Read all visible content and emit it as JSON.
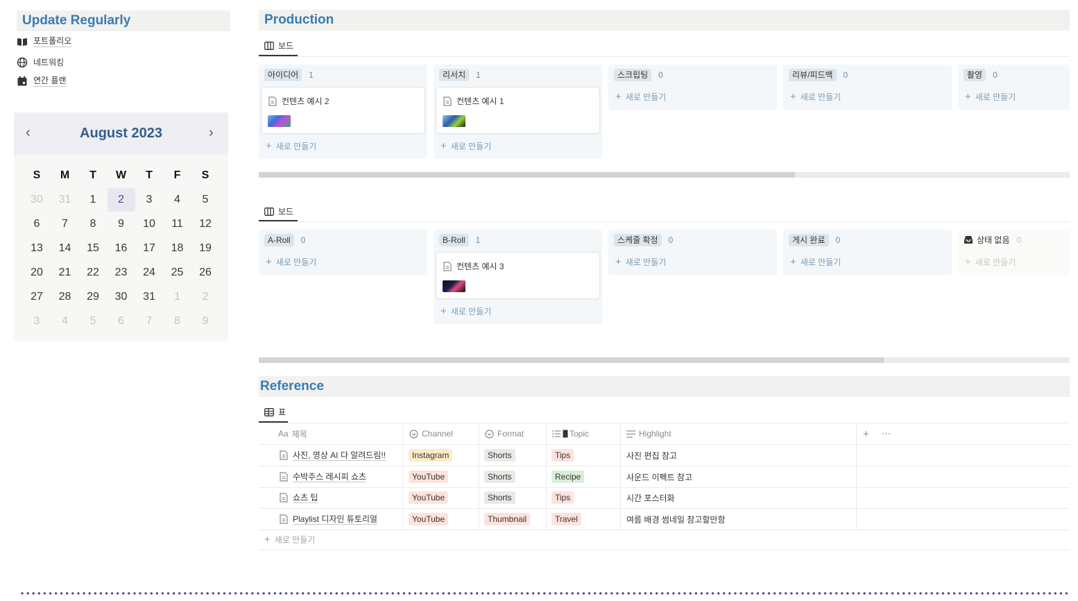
{
  "sidebar": {
    "title": "Update Regularly",
    "links": [
      {
        "label": "포트폴리오",
        "icon": "book-open-icon"
      },
      {
        "label": "네트워킹",
        "icon": "globe-icon"
      },
      {
        "label": "연간 플랜",
        "icon": "calendar-icon"
      }
    ]
  },
  "calendar": {
    "title": "August 2023",
    "weekdays": [
      "S",
      "M",
      "T",
      "W",
      "T",
      "F",
      "S"
    ],
    "weeks": [
      [
        "30",
        "31",
        "1",
        "2",
        "3",
        "4",
        "5"
      ],
      [
        "6",
        "7",
        "8",
        "9",
        "10",
        "11",
        "12"
      ],
      [
        "13",
        "14",
        "15",
        "16",
        "17",
        "18",
        "19"
      ],
      [
        "20",
        "21",
        "22",
        "23",
        "24",
        "25",
        "26"
      ],
      [
        "27",
        "28",
        "29",
        "30",
        "31",
        "1",
        "2"
      ],
      [
        "3",
        "4",
        "5",
        "6",
        "7",
        "8",
        "9"
      ]
    ]
  },
  "production": {
    "title": "Production",
    "board1": {
      "view_label": "보드",
      "columns": [
        {
          "name": "아이디어",
          "count": "1",
          "card": "컨텐츠 예시 2"
        },
        {
          "name": "리서치",
          "count": "1",
          "card": "컨텐츠 예시 1"
        },
        {
          "name": "스크립팅",
          "count": "0"
        },
        {
          "name": "리뷰/피드백",
          "count": "0"
        },
        {
          "name": "촬영",
          "count": "0"
        }
      ]
    },
    "board2": {
      "view_label": "보드",
      "columns": [
        {
          "name": "A-Roll",
          "count": "0"
        },
        {
          "name": "B-Roll",
          "count": "1",
          "card": "컨텐츠 예시 3"
        },
        {
          "name": "스케줄 확정",
          "count": "0"
        },
        {
          "name": "게시 완료",
          "count": "0"
        },
        {
          "name": "상태 없음",
          "count": "0"
        }
      ]
    },
    "new_label": "새로 만들기"
  },
  "reference": {
    "title": "Reference",
    "view_label": "표",
    "headers": {
      "name": "제목",
      "name_prefix": "Aa",
      "channel": "Channel",
      "format": "Format",
      "topic": "Topic",
      "highlight": "Highlight"
    },
    "rows": [
      {
        "name": "사진, 영상 AI 다 알려드림!!",
        "channel": "Instagram",
        "format": "Shorts",
        "topic": "Tips",
        "highlight": "사진 편집 참고"
      },
      {
        "name": "수박주스 레시피 쇼츠",
        "channel": "YouTube",
        "format": "Shorts",
        "topic": "Recipe",
        "highlight": "사운드 이펙트 참고"
      },
      {
        "name": "쇼츠 팁",
        "channel": "YouTube",
        "format": "Shorts",
        "topic": "Tips",
        "highlight": "시간 포스터화"
      },
      {
        "name": "Playlist 디자인 튜토리얼",
        "channel": "YouTube",
        "format": "Thumbnail",
        "topic": "Travel",
        "highlight": "여름 배경 썸네일 참고할만함"
      }
    ],
    "new_label": "새로 만들기"
  },
  "colors": {
    "accent": "#3a7bb0",
    "instagram": "#fbecc8",
    "youtube": "#fde2dd",
    "format_tag": "#e9e9e7",
    "tips": "#fde2dd",
    "recipe": "#dbeddb",
    "travel": "#fde2dd"
  }
}
